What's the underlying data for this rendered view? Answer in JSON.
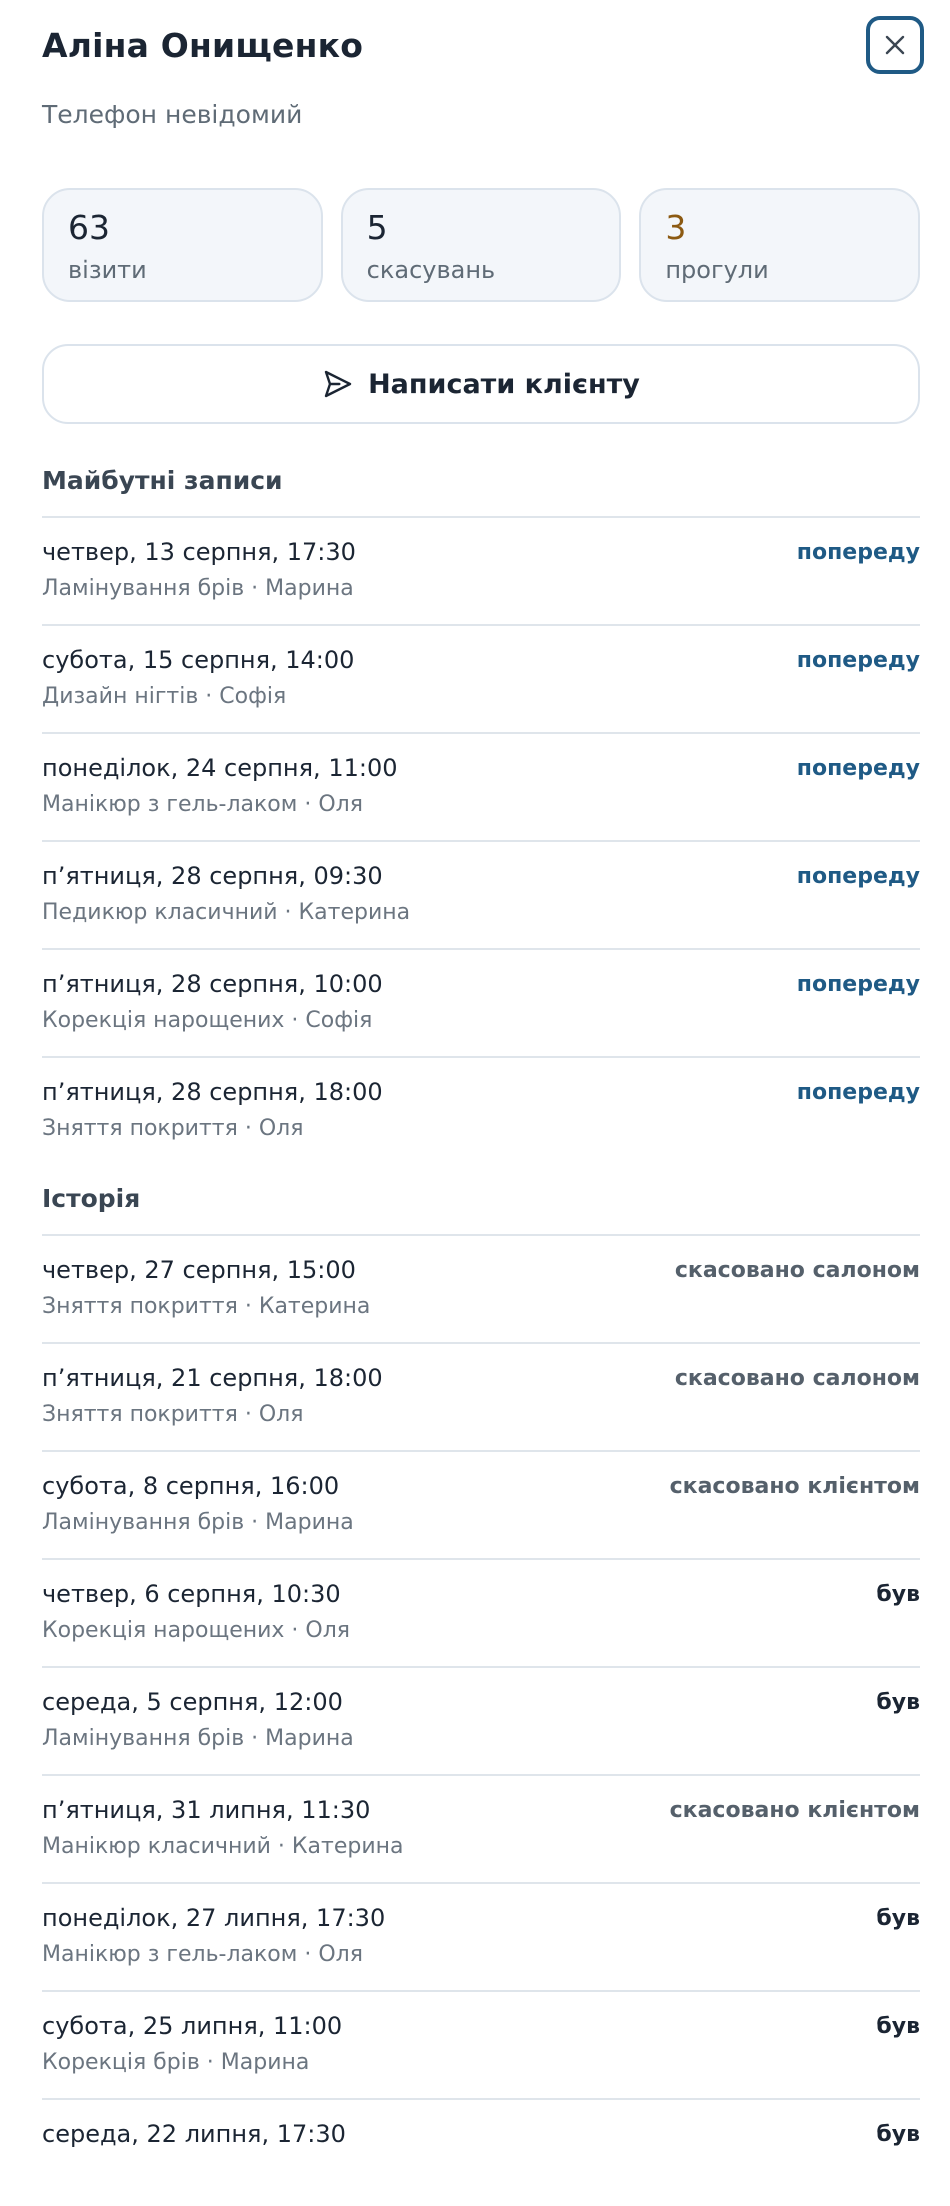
{
  "client": {
    "name": "Аліна Онищенко",
    "phone": "Телефон невідомий"
  },
  "icons": {
    "close": "close-icon",
    "send": "send-icon"
  },
  "colors": {
    "accent": "#1f5a85",
    "warn": "#8c5a12",
    "stat_bg": "#f3f6fa"
  },
  "stats": [
    {
      "value": "63",
      "label": "візити"
    },
    {
      "value": "5",
      "label": "скасувань"
    },
    {
      "value": "3",
      "label": "прогули"
    }
  ],
  "message_button": {
    "label": "Написати клієнту"
  },
  "upcoming": {
    "title": "Майбутні записи",
    "items": [
      {
        "when": "четвер, 13 серпня, 17:30",
        "what": "Ламінування брів · Марина",
        "status": "попереду"
      },
      {
        "when": "субота, 15 серпня, 14:00",
        "what": "Дизайн нігтів · Софія",
        "status": "попереду"
      },
      {
        "when": "понеділок, 24 серпня, 11:00",
        "what": "Манікюр з гель-лаком · Оля",
        "status": "попереду"
      },
      {
        "when": "п’ятниця, 28 серпня, 09:30",
        "what": "Педикюр класичний · Катерина",
        "status": "попереду"
      },
      {
        "when": "п’ятниця, 28 серпня, 10:00",
        "what": "Корекція нарощених · Софія",
        "status": "попереду"
      },
      {
        "when": "п’ятниця, 28 серпня, 18:00",
        "what": "Зняття покриття · Оля",
        "status": "попереду"
      }
    ]
  },
  "history": {
    "title": "Історія",
    "items": [
      {
        "when": "четвер, 27 серпня, 15:00",
        "what": "Зняття покриття · Катерина",
        "status": "скасовано салоном"
      },
      {
        "when": "п’ятниця, 21 серпня, 18:00",
        "what": "Зняття покриття · Оля",
        "status": "скасовано салоном"
      },
      {
        "when": "субота, 8 серпня, 16:00",
        "what": "Ламінування брів · Марина",
        "status": "скасовано клієнтом"
      },
      {
        "when": "четвер, 6 серпня, 10:30",
        "what": "Корекція нарощених · Оля",
        "status": "був"
      },
      {
        "when": "середа, 5 серпня, 12:00",
        "what": "Ламінування брів · Марина",
        "status": "був"
      },
      {
        "when": "п’ятниця, 31 липня, 11:30",
        "what": "Манікюр класичний · Катерина",
        "status": "скасовано клієнтом"
      },
      {
        "when": "понеділок, 27 липня, 17:30",
        "what": "Манікюр з гель-лаком · Оля",
        "status": "був"
      },
      {
        "when": "субота, 25 липня, 11:00",
        "what": "Корекція брів · Марина",
        "status": "був"
      },
      {
        "when": "середа, 22 липня, 17:30",
        "what": "",
        "status": "був"
      }
    ]
  }
}
